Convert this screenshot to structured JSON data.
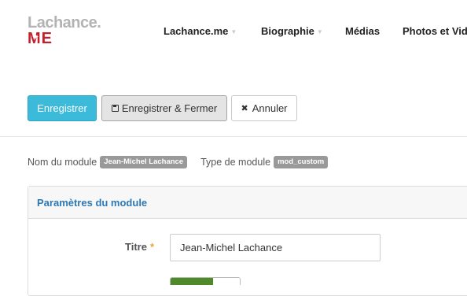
{
  "logo": {
    "top": "Lachance.",
    "bottom_m": "M",
    "bottom_e": "E"
  },
  "nav": [
    {
      "label": "Lachance.me",
      "has_caret": true
    },
    {
      "label": "Biographie",
      "has_caret": true
    },
    {
      "label": "Médias",
      "has_caret": false
    },
    {
      "label": "Photos et Vid",
      "has_caret": false
    }
  ],
  "toolbar": {
    "save_label": "Enregistrer",
    "save_close_label": "Enregistrer & Fermer",
    "cancel_label": "Annuler"
  },
  "module_info": {
    "name_label": "Nom du module",
    "name_value": "Jean-Michel Lachance",
    "type_label": "Type de module",
    "type_value": "mod_custom"
  },
  "panel": {
    "heading": "Paramètres du module",
    "title_label": "Titre",
    "required_mark": "*",
    "title_value": "Jean-Michel Lachance"
  },
  "colors": {
    "accent": "#3cbad9",
    "link": "#2d79b5",
    "logo_red": "#c51f2b",
    "badge": "#999999",
    "toggle_on": "#4e8a2a"
  }
}
